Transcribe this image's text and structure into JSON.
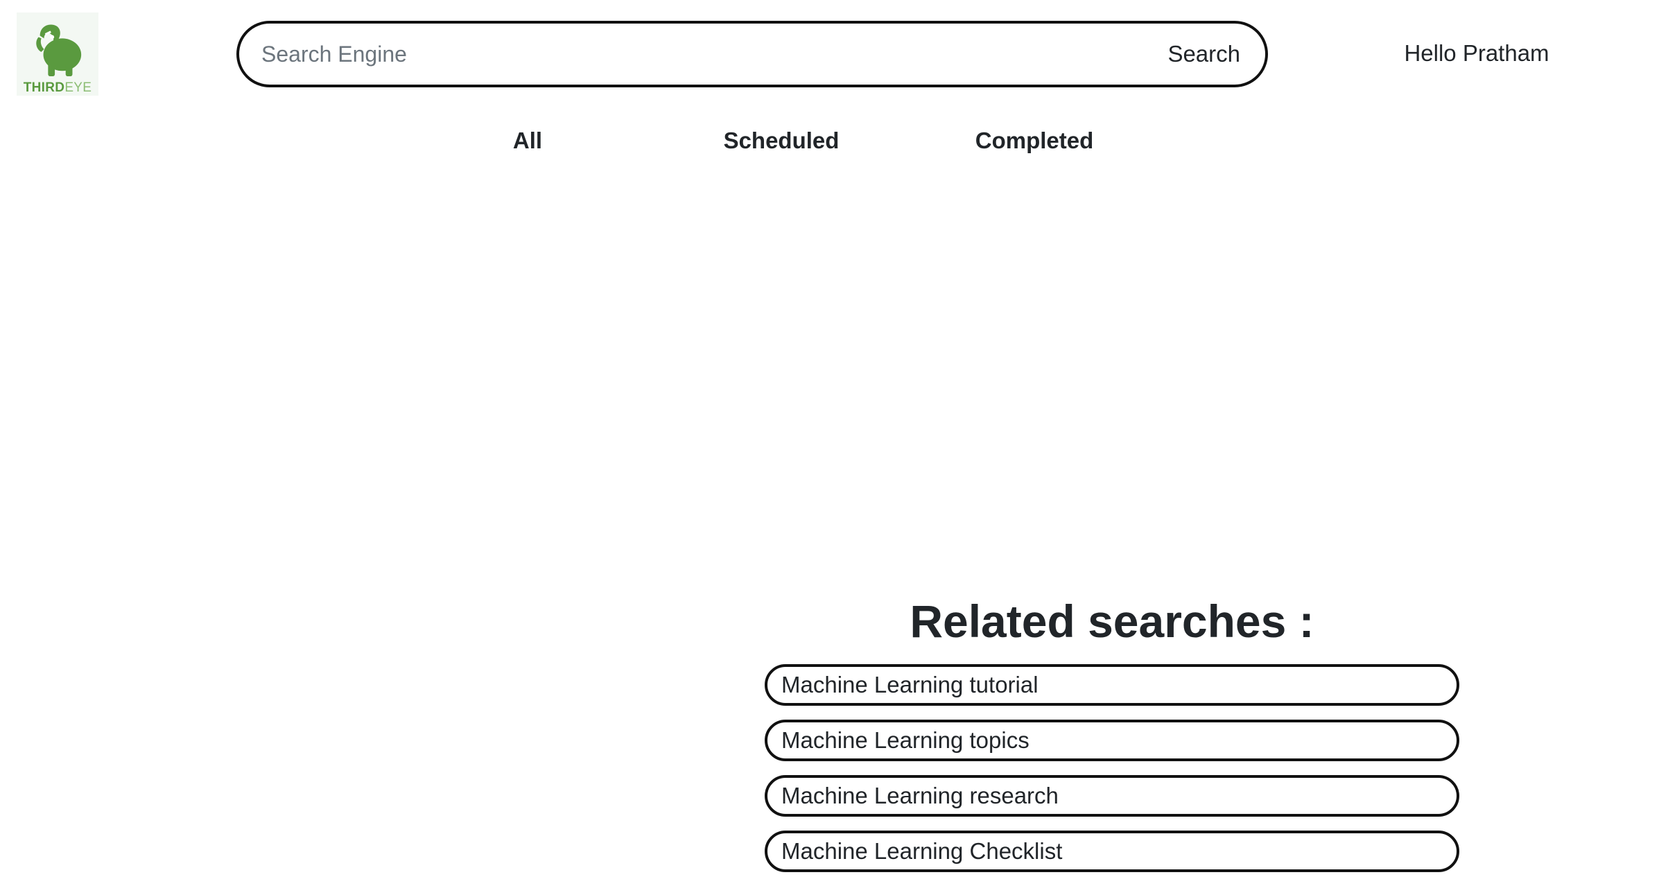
{
  "logo": {
    "part1": "THIRD",
    "part2": "EYE",
    "icon": "elephant-icon",
    "color": "#5a9a3f"
  },
  "search": {
    "placeholder": "Search Engine",
    "value": "",
    "button_label": "Search"
  },
  "header": {
    "greeting": "Hello Pratham"
  },
  "tabs": [
    {
      "label": "All"
    },
    {
      "label": "Scheduled"
    },
    {
      "label": "Completed"
    }
  ],
  "related": {
    "title": "Related searches :",
    "items": [
      {
        "label": "Machine Learning tutorial"
      },
      {
        "label": "Machine Learning topics"
      },
      {
        "label": "Machine Learning research"
      },
      {
        "label": "Machine Learning Checklist"
      }
    ]
  }
}
